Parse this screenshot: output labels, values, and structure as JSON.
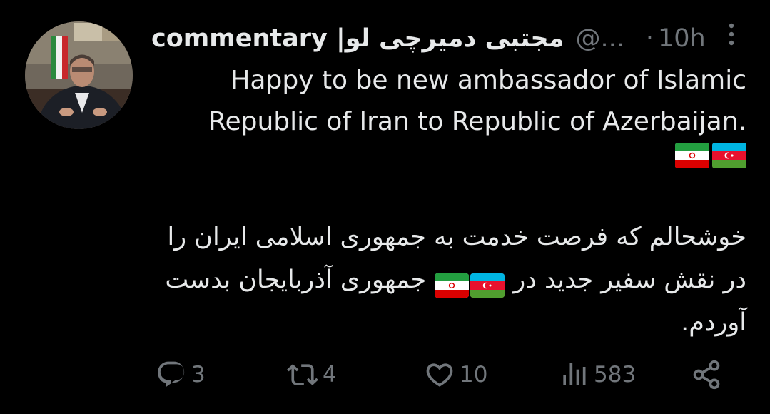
{
  "tweet": {
    "display_name": "commentary |مجتبی دمیرچی لو",
    "handle": "@...",
    "separator": "·",
    "time": "10h",
    "text_en": "Happy to be new ambassador of Islamic Republic of Iran to Republic of Azerbaijan.",
    "text_fa_1": "خوشحالم که فرصت خدمت به جمهوری اسلامی ایران را در نقش سفیر جدید در",
    "text_fa_2": "جمهوری آذربایجان بدست آوردم.",
    "flags": [
      "iran-flag-icon",
      "azerbaijan-flag-icon"
    ]
  },
  "actions": {
    "replies": "3",
    "retweets": "4",
    "likes": "10",
    "views": "583"
  },
  "colors": {
    "background": "#000000",
    "text": "#e7e9ea",
    "muted": "#71767b"
  }
}
